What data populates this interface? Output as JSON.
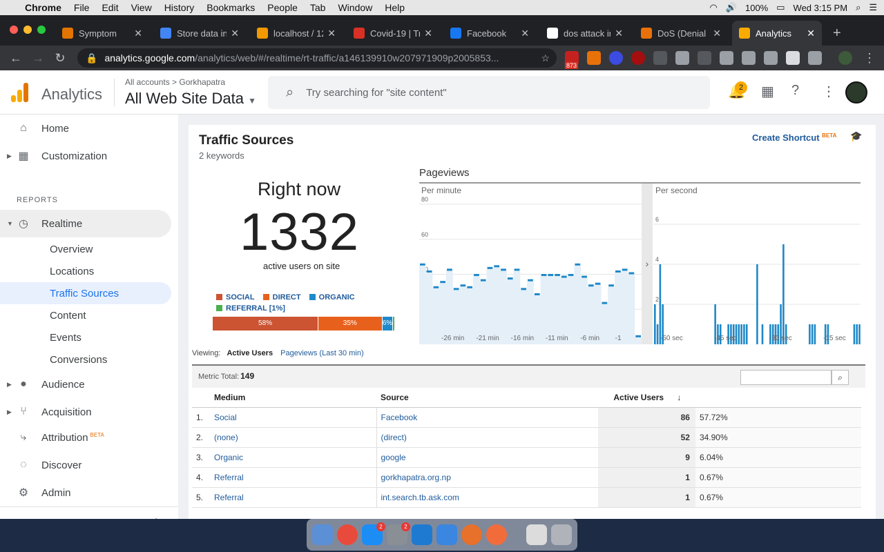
{
  "menubar": {
    "app": "Chrome",
    "items": [
      "File",
      "Edit",
      "View",
      "History",
      "Bookmarks",
      "People",
      "Tab",
      "Window",
      "Help"
    ],
    "battery": "100%",
    "clock": "Wed 3:15 PM"
  },
  "tabs": [
    {
      "title": "Symptom",
      "color": "#e37400"
    },
    {
      "title": "Store data in",
      "color": "#4285f4"
    },
    {
      "title": "localhost / 12",
      "color": "#f29900"
    },
    {
      "title": "Covid-19 | Tr",
      "color": "#d93025"
    },
    {
      "title": "Facebook",
      "color": "#1877f2"
    },
    {
      "title": "dos attack in",
      "color": "#ffffff"
    },
    {
      "title": "DoS (Denial o",
      "color": "#e8710a"
    },
    {
      "title": "Analytics",
      "color": "#f9ab00"
    }
  ],
  "url": {
    "domain": "analytics.google.com",
    "path": "/analytics/web/#/realtime/rt-traffic/a146139910w207971909p2005853..."
  },
  "ext": {
    "gmail_count": "873"
  },
  "header": {
    "brand": "Analytics",
    "breadcrumb": "All accounts > Gorkhapatra",
    "view": "All Web Site Data",
    "search_placeholder": "Try searching for \"site content\"",
    "notifications": "2"
  },
  "sidebar": {
    "home": "Home",
    "customization": "Customization",
    "reports": "REPORTS",
    "realtime": "Realtime",
    "sub": [
      "Overview",
      "Locations",
      "Traffic Sources",
      "Content",
      "Events",
      "Conversions"
    ],
    "audience": "Audience",
    "acquisition": "Acquisition",
    "attribution": "Attribution",
    "beta": "BETA",
    "discover": "Discover",
    "admin": "Admin"
  },
  "page": {
    "title": "Traffic Sources",
    "subtitle": "2 keywords",
    "shortcut": "Create Shortcut",
    "beta": "BETA"
  },
  "rightnow": {
    "label": "Right now",
    "count": "1332",
    "caption": "active users on site"
  },
  "legend": [
    {
      "label": "SOCIAL",
      "color": "#cc5433"
    },
    {
      "label": "DIRECT",
      "color": "#e8611c"
    },
    {
      "label": "ORGANIC",
      "color": "#1f8ac9"
    },
    {
      "label": "REFERRAL [1%]",
      "color": "#4caf50"
    }
  ],
  "breakdown": [
    {
      "label": "58%",
      "value": 58,
      "color": "#cc5433"
    },
    {
      "label": "35%",
      "value": 35,
      "color": "#e8611c"
    },
    {
      "label": "6%",
      "value": 6,
      "color": "#1f8ac9"
    },
    {
      "label": "",
      "value": 1,
      "color": "#4caf50"
    }
  ],
  "pageviews": {
    "title": "Pageviews",
    "per_minute": "Per minute",
    "per_second": "Per second"
  },
  "chart_data": [
    {
      "type": "bar",
      "title": "Per minute",
      "ylim": [
        0,
        80
      ],
      "yticks": [
        20,
        40,
        60,
        80
      ],
      "xticks": [
        "-26 min",
        "-21 min",
        "-16 min",
        "-11 min",
        "-6 min",
        "-1"
      ],
      "x": [
        -30,
        -29,
        -28,
        -27,
        -26,
        -25,
        -24,
        -23,
        -22,
        -21,
        -20,
        -19,
        -18,
        -17,
        -16,
        -15,
        -14,
        -13,
        -12,
        -11,
        -10,
        -9,
        -8,
        -7,
        -6,
        -5,
        -4,
        -3,
        -2,
        -1
      ],
      "values": [
        45,
        41,
        32,
        35,
        42,
        31,
        33,
        32,
        39,
        36,
        43,
        44,
        42,
        37,
        42,
        31,
        36,
        28,
        39,
        39,
        39,
        38,
        39,
        45,
        38,
        33,
        34,
        23,
        33,
        41,
        42,
        40,
        4
      ]
    },
    {
      "type": "bar",
      "title": "Per second",
      "ylim": [
        0,
        7
      ],
      "yticks": [
        2,
        4,
        6
      ],
      "xticks": [
        "-50 sec",
        "-45 sec",
        "-30 sec",
        "-15 sec"
      ],
      "values": [
        2,
        1,
        4,
        2,
        0,
        0,
        0,
        0,
        0,
        0,
        0,
        0,
        0,
        0,
        0,
        0,
        0,
        0,
        0,
        0,
        0,
        0,
        0,
        2,
        1,
        1,
        0,
        0,
        1,
        1,
        1,
        1,
        1,
        1,
        1,
        1,
        0,
        0,
        0,
        4,
        0,
        1,
        0,
        0,
        1,
        1,
        1,
        1,
        2,
        5,
        1,
        0,
        0,
        0,
        0,
        0,
        0,
        0,
        0,
        1,
        1,
        1,
        0,
        0,
        0,
        1,
        1,
        0,
        0,
        0,
        0,
        0,
        0,
        0,
        0,
        0,
        1,
        1,
        1
      ]
    }
  ],
  "table": {
    "viewing": "Viewing:",
    "view_active": "Active Users",
    "view_pageviews": "Pageviews (Last 30 min)",
    "metric_label": "Metric Total:",
    "metric_total": "149",
    "headers": [
      "Medium",
      "Source",
      "Active Users"
    ],
    "rows": [
      {
        "num": "1.",
        "medium": "Social",
        "source": "Facebook",
        "users": "86",
        "pct": "57.72%"
      },
      {
        "num": "2.",
        "medium": "(none)",
        "source": "(direct)",
        "users": "52",
        "pct": "34.90%"
      },
      {
        "num": "3.",
        "medium": "Organic",
        "source": "google",
        "users": "9",
        "pct": "6.04%"
      },
      {
        "num": "4.",
        "medium": "Referral",
        "source": "gorkhapatra.org.np",
        "users": "1",
        "pct": "0.67%"
      },
      {
        "num": "5.",
        "medium": "Referral",
        "source": "int.search.tb.ask.com",
        "users": "1",
        "pct": "0.67%"
      }
    ]
  }
}
